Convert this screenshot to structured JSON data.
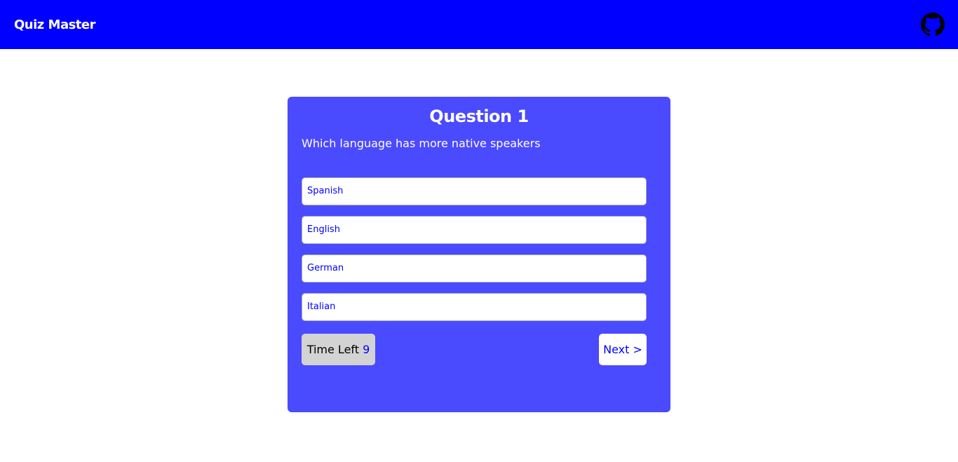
{
  "navbar": {
    "brand": "Quiz Master",
    "github_icon": "github-icon",
    "background": "#0000ff"
  },
  "quiz": {
    "title": "Question 1",
    "question": "Which language has more native speakers",
    "options": [
      {
        "label": "Spanish"
      },
      {
        "label": "English"
      },
      {
        "label": "German"
      },
      {
        "label": "Italian"
      }
    ],
    "timer_label": "Time Left",
    "timer_value": "9",
    "next_label": "Next >",
    "card_color": "#4a4aff",
    "accent": "#0000ff"
  }
}
